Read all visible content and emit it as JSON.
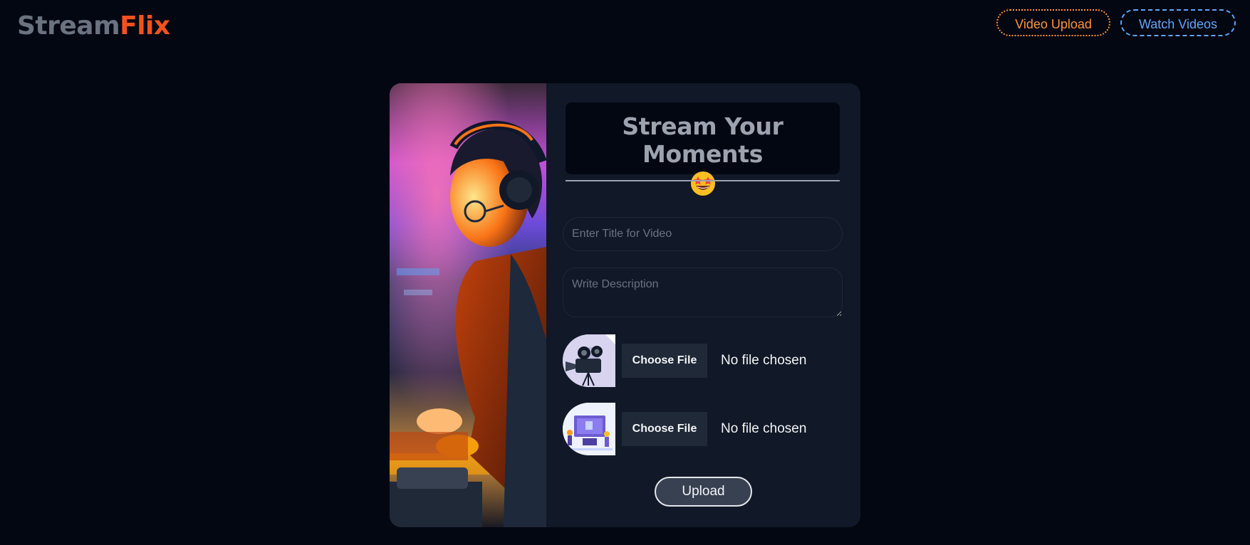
{
  "brand": {
    "part1": "Stream",
    "part2": "Flix"
  },
  "nav": {
    "upload_label": "Video Upload",
    "watch_label": "Watch Videos"
  },
  "card": {
    "title": "Stream Your Moments",
    "title_emoji_icon": "star-struck-emoji-icon",
    "title_placeholder": "Enter Title for Video",
    "description_placeholder": "Write Description",
    "video_file": {
      "button_label": "Choose File",
      "status": "No file chosen",
      "icon": "video-camera-icon"
    },
    "thumbnail_file": {
      "button_label": "Choose File",
      "status": "No file chosen",
      "icon": "thumbnail-illustration-icon"
    },
    "submit_label": "Upload"
  },
  "colors": {
    "background": "#030712",
    "card": "#111827",
    "brand_accent": "#f4511e",
    "upload_nav": "#fb923c",
    "watch_nav": "#60a5fa"
  }
}
